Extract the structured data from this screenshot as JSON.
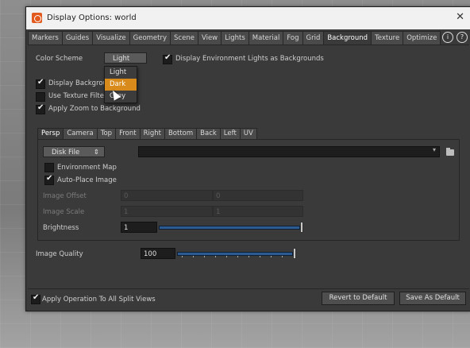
{
  "window": {
    "title": "Display Options:  world"
  },
  "tabs": [
    "Markers",
    "Guides",
    "Visualize",
    "Geometry",
    "Scene",
    "View",
    "Lights",
    "Material",
    "Fog",
    "Grid",
    "Background",
    "Texture",
    "Optimize"
  ],
  "active_tab": "Background",
  "color_scheme": {
    "label": "Color Scheme",
    "value": "Light",
    "options": [
      "Light",
      "Dark",
      "Grey"
    ],
    "highlighted": "Dark"
  },
  "checks": {
    "env_lights": "Display Environment Lights as Backgrounds",
    "display_background": "Display Background",
    "texture_filter": "Use Texture Filtering",
    "apply_zoom": "Apply Zoom to Background"
  },
  "viewport_tabs": [
    "Persp",
    "Camera",
    "Top",
    "Front",
    "Right",
    "Bottom",
    "Back",
    "Left",
    "UV"
  ],
  "source": {
    "value": "Disk File",
    "file": ""
  },
  "env_map": "Environment Map",
  "auto_place": "Auto-Place Image",
  "image_offset": {
    "label": "Image Offset",
    "x": "0",
    "y": "0"
  },
  "image_scale": {
    "label": "Image Scale",
    "x": "1",
    "y": "1"
  },
  "brightness": {
    "label": "Brightness",
    "value": "1",
    "level": 1.0
  },
  "image_quality": {
    "label": "Image Quality",
    "value": "100",
    "level": 1.0
  },
  "footer": {
    "apply_all": "Apply Operation To All Split Views",
    "revert": "Revert to Default",
    "save": "Save As Default"
  }
}
